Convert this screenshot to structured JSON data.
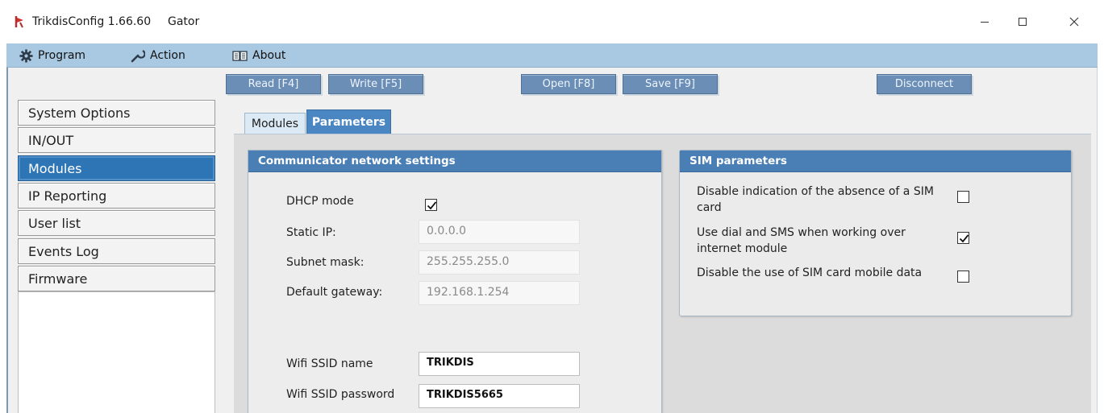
{
  "window": {
    "title": "TrikdisConfig 1.66.60",
    "model": "Gator",
    "controls": {
      "minimize": "—",
      "maximize": "☐",
      "close": "✕"
    }
  },
  "menu": {
    "items": [
      {
        "label": "Program",
        "icon": "gear-icon"
      },
      {
        "label": "Action",
        "icon": "wrench-icon"
      },
      {
        "label": "About",
        "icon": "book-icon"
      }
    ]
  },
  "toolbar": {
    "read": "Read [F4]",
    "write": "Write [F5]",
    "open": "Open [F8]",
    "save": "Save [F9]",
    "disconnect": "Disconnect"
  },
  "sidebar": {
    "items": [
      {
        "label": "System Options",
        "active": false
      },
      {
        "label": "IN/OUT",
        "active": false
      },
      {
        "label": "Modules",
        "active": true
      },
      {
        "label": "IP Reporting",
        "active": false
      },
      {
        "label": "User list",
        "active": false
      },
      {
        "label": "Events Log",
        "active": false
      },
      {
        "label": "Firmware",
        "active": false
      }
    ]
  },
  "tabs": [
    {
      "label": "Modules",
      "active": false
    },
    {
      "label": "Parameters",
      "active": true
    }
  ],
  "network": {
    "header": "Communicator network settings",
    "dhcp_label": "DHCP mode",
    "dhcp_checked": true,
    "static_ip_label": "Static IP:",
    "static_ip": "0.0.0.0",
    "subnet_label": "Subnet mask:",
    "subnet": "255.255.255.0",
    "gateway_label": "Default gateway:",
    "gateway": "192.168.1.254",
    "ssid_label": "Wifi SSID name",
    "ssid": "TRIKDIS",
    "password_label": "Wifi SSID password",
    "password": "TRIKDIS5665"
  },
  "sim": {
    "header": "SIM parameters",
    "options": [
      {
        "label": "Disable indication of the absence of a SIM card",
        "checked": false
      },
      {
        "label": "Use dial and SMS when working over internet module",
        "checked": true
      },
      {
        "label": "Disable the use of SIM card mobile data",
        "checked": false
      }
    ]
  },
  "colors": {
    "menubar": "#a9c9e2",
    "toolbar_button": "#6b8eb7",
    "active_nav": "#2e75b6",
    "group_header": "#4a7fb5"
  }
}
